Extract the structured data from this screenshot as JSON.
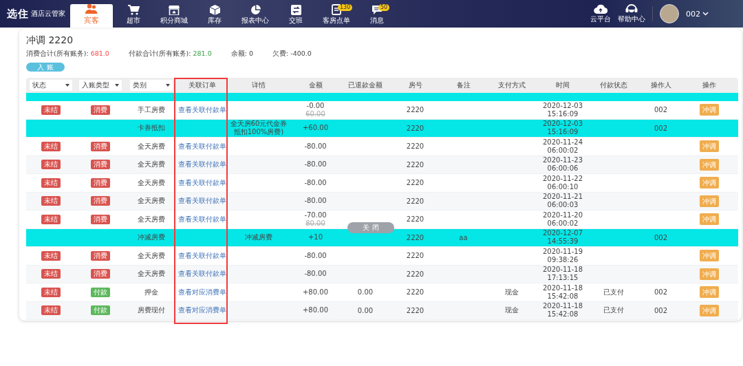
{
  "topbar": {
    "logo": {
      "mark": "选住",
      "name": "酒店云管家"
    },
    "nav": [
      {
        "label": "宾客",
        "selected": true
      },
      {
        "label": "超市",
        "selected": false
      },
      {
        "label": "积分商城",
        "selected": false
      },
      {
        "label": "库存",
        "selected": false
      },
      {
        "label": "报表中心",
        "selected": false
      },
      {
        "label": "交班",
        "selected": false
      },
      {
        "label": "客房点单",
        "badge": "130",
        "selected": false
      },
      {
        "label": "消息",
        "badge": "50",
        "selected": false
      }
    ],
    "tools": [
      {
        "label": "云平台"
      },
      {
        "label": "帮助中心"
      }
    ],
    "user": {
      "name": "002"
    }
  },
  "panel": {
    "title": "冲调 2220",
    "summary": [
      {
        "label": "消费合计(所有账务): ",
        "value": "681.0",
        "color": "#f04848"
      },
      {
        "label": "付款合计(所有账务): ",
        "value": "281.0",
        "color": "#3aa046"
      },
      {
        "label": "余额: ",
        "value": "0"
      },
      {
        "label": "欠费: ",
        "value": "-400.0"
      }
    ],
    "post_button": "入 账"
  },
  "table": {
    "filters": [
      "状态",
      "入账类型",
      "类别"
    ],
    "columns": [
      "关联订单",
      "详情",
      "金额",
      "已退款金额",
      "房号",
      "备注",
      "支付方式",
      "时间",
      "付款状态",
      "操作人",
      "操作"
    ],
    "rows": [
      {
        "kind": "normal",
        "status": "未结",
        "type": {
          "text": "消费",
          "color": "#d9534f"
        },
        "category": "手工房费",
        "link": "查看关联付款单",
        "amount": "-0.00",
        "original_amount": "60.00",
        "room": "2220",
        "time": [
          "2020-12-03",
          "15:16:09"
        ],
        "operator": "002",
        "action": "冲调"
      },
      {
        "kind": "highlight",
        "category": "卡券抵扣",
        "detail": [
          "全天房60元代金券",
          "抵扣100%房费)"
        ],
        "amount": "+60.00",
        "room": "2220",
        "time": [
          "2020-12-03",
          "15:16:09"
        ],
        "operator": "002"
      },
      {
        "kind": "normal",
        "status": "未结",
        "type": {
          "text": "消费",
          "color": "#d9534f"
        },
        "category": "全天房费",
        "link": "查看关联付款单",
        "amount": "-80.00",
        "room": "2220",
        "time": [
          "2020-11-24",
          "06:00:02"
        ],
        "action": "冲调"
      },
      {
        "kind": "normal",
        "status": "未结",
        "type": {
          "text": "消费",
          "color": "#d9534f"
        },
        "category": "全天房费",
        "link": "查看关联付款单",
        "amount": "-80.00",
        "room": "2220",
        "time": [
          "2020-11-23",
          "06:00:06"
        ],
        "action": "冲调"
      },
      {
        "kind": "normal",
        "status": "未结",
        "type": {
          "text": "消费",
          "color": "#d9534f"
        },
        "category": "全天房费",
        "link": "查看关联付款单",
        "amount": "-80.00",
        "room": "2220",
        "time": [
          "2020-11-22",
          "06:00:10"
        ],
        "action": "冲调"
      },
      {
        "kind": "normal",
        "status": "未结",
        "type": {
          "text": "消费",
          "color": "#d9534f"
        },
        "category": "全天房费",
        "link": "查看关联付款单",
        "amount": "-80.00",
        "room": "2220",
        "time": [
          "2020-11-21",
          "06:00:03"
        ],
        "action": "冲调"
      },
      {
        "kind": "normal",
        "status": "未结",
        "type": {
          "text": "消费",
          "color": "#d9534f"
        },
        "category": "全天房费",
        "link": "查看关联付款单",
        "amount": "-70.00",
        "original_amount": "80.00",
        "room": "2220",
        "time": [
          "2020-11-20",
          "06:00:02"
        ],
        "action": "冲调"
      },
      {
        "kind": "highlight",
        "category": "冲减房费",
        "detail": [
          "冲减房费"
        ],
        "amount": "+10",
        "room": "2220",
        "note": "aa",
        "time": [
          "2020-12-07",
          "14:55:39"
        ],
        "operator": "002"
      },
      {
        "kind": "normal",
        "status": "未结",
        "type": {
          "text": "消费",
          "color": "#d9534f"
        },
        "category": "全天房费",
        "link": "查看关联付款单",
        "amount": "-80.00",
        "room": "2220",
        "time": [
          "2020-11-19",
          "09:38:26"
        ],
        "action": "冲调"
      },
      {
        "kind": "normal",
        "status": "未结",
        "type": {
          "text": "消费",
          "color": "#d9534f"
        },
        "category": "全天房费",
        "link": "查看关联付款单",
        "amount": "-80.00",
        "room": "2220",
        "time": [
          "2020-11-18",
          "17:13:15"
        ],
        "action": "冲调"
      },
      {
        "kind": "normal",
        "status": "未结",
        "type": {
          "text": "付款",
          "color": "#5cb85c"
        },
        "category": "押金",
        "link": "查看对应消费单",
        "amount": "+80.00",
        "refunded": "0.00",
        "room": "2220",
        "payment": "现金",
        "time": [
          "2020-11-18",
          "15:42:08"
        ],
        "pay_status": "已支付",
        "operator": "002",
        "action": "冲调"
      },
      {
        "kind": "normal",
        "status": "未结",
        "type": {
          "text": "付款",
          "color": "#5cb85c"
        },
        "category": "房费现付",
        "link": "查看对应消费单",
        "amount": "+80.00",
        "refunded": "0.00",
        "room": "2220",
        "payment": "现金",
        "time": [
          "2020-11-18",
          "15:42:08"
        ],
        "pay_status": "已支付",
        "operator": "002",
        "action": "冲调"
      }
    ]
  },
  "close_button": "关 闭"
}
